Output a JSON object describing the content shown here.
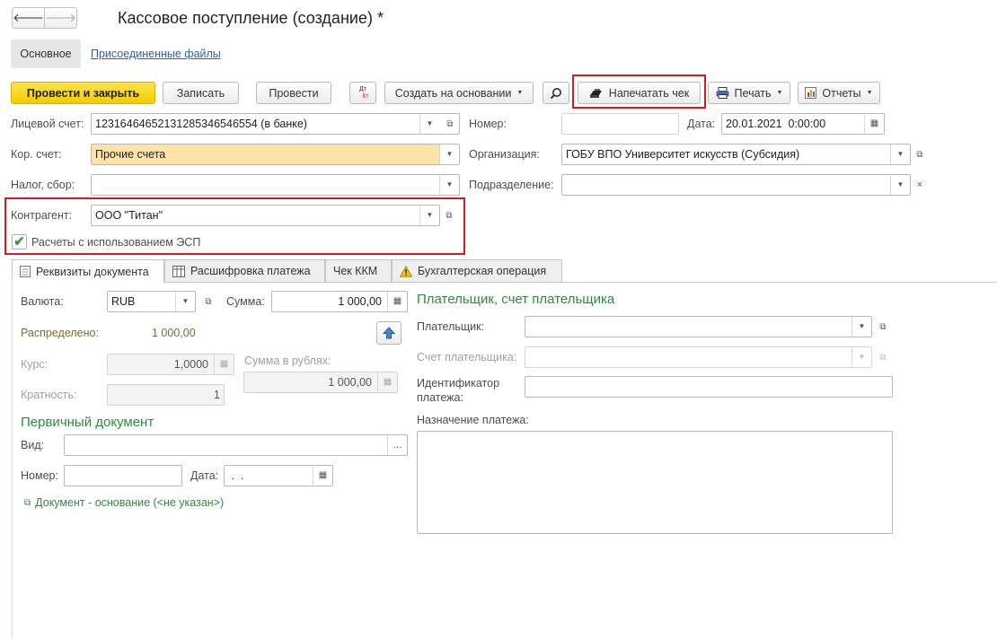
{
  "window": {
    "title": "Кассовое поступление (создание) *"
  },
  "nav": {
    "back": "🡐",
    "forward": "🡒"
  },
  "top_tabs": {
    "main": "Основное",
    "files": "Присоединенные файлы"
  },
  "toolbar": {
    "post_close": "Провести и закрыть",
    "save": "Записать",
    "post": "Провести",
    "dt_kt_top": "Дт",
    "dt_kt_bottom": "Кт",
    "create_based": "Создать на основании",
    "print_receipt": "Напечатать чек",
    "print": "Печать",
    "reports": "Отчеты"
  },
  "header": {
    "account_label": "Лицевой счет:",
    "account_value": "12316464652131285346546554 (в банке)",
    "number_label": "Номер:",
    "number_value": "",
    "date_label": "Дата:",
    "date_value": "20.01.2021  0:00:00",
    "corr_label": "Кор. счет:",
    "corr_value": "Прочие счета",
    "org_label": "Организация:",
    "org_value": "ГОБУ ВПО Университет искусств (Субсидия)",
    "tax_label": "Налог, сбор:",
    "tax_value": "",
    "dept_label": "Подразделение:",
    "dept_value": "",
    "contractor_label": "Контрагент:",
    "contractor_value": "ООО \"Титан\"",
    "esp_label": "Расчеты с использованием ЭСП",
    "esp_checked": true
  },
  "tabs": [
    "Реквизиты документа",
    "Расшифровка платежа",
    "Чек ККМ",
    "Бухгалтерская операция"
  ],
  "details": {
    "currency_label": "Валюта:",
    "currency_value": "RUB",
    "sum_label": "Сумма:",
    "sum_value": "1 000,00",
    "distributed_label": "Распределено:",
    "distributed_value": "1 000,00",
    "rate_label": "Курс:",
    "rate_value": "1,0000",
    "rub_sum_label": "Сумма в рублях:",
    "rub_sum_value": "1 000,00",
    "multiplicity_label": "Кратность:",
    "multiplicity_value": "1",
    "primary_doc_title": "Первичный документ",
    "kind_label": "Вид:",
    "kind_value": "",
    "doc_number_label": "Номер:",
    "doc_date_label": "Дата:",
    "doc_date_value": " .  .",
    "base_doc_link": "Документ - основание (<не указан>)"
  },
  "payer": {
    "title": "Плательщик, счет плательщика",
    "payer_label": "Плательщик:",
    "payer_account_label": "Счет плательщика:",
    "payment_id_label_1": "Идентификатор",
    "payment_id_label_2": "платежа:",
    "purpose_label": "Назначение платежа:"
  },
  "colors": {
    "primary_button": "#f5d10a",
    "highlight_box": "#e2171b",
    "section_title": "#2e8b3f",
    "required_field": "#fde3a7"
  }
}
